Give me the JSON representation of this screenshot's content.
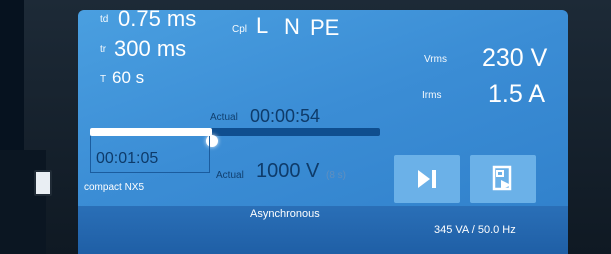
{
  "params": {
    "td": {
      "label": "td",
      "value": "0.75 ms"
    },
    "tr": {
      "label": "tr",
      "value": "300 ms"
    },
    "T": {
      "label": "T",
      "value": "60 s"
    }
  },
  "coupling": {
    "label": "Cpl",
    "values": [
      "L",
      "N",
      "PE"
    ]
  },
  "measurements": {
    "vrms": {
      "label": "Vrms",
      "value": "230 V"
    },
    "irms": {
      "label": "Irms",
      "value": "1.5 A"
    }
  },
  "timer": {
    "actual_label": "Actual",
    "actual_time": "00:00:54",
    "set_time": "00:01:05",
    "progress": 0.42
  },
  "pulse": {
    "actual_label": "Actual",
    "value": "1000 V",
    "interval": "(8 s)"
  },
  "buttons": {
    "skip": "skip-forward-icon",
    "export": "export-icon"
  },
  "status": {
    "device": "compact NX5",
    "mode": "Asynchronous",
    "power": "345 VA / 50.0 Hz"
  },
  "colors": {
    "screen": "#3b8dd5",
    "dark_text": "#0e3b6a",
    "button": "#6bb1e8"
  }
}
